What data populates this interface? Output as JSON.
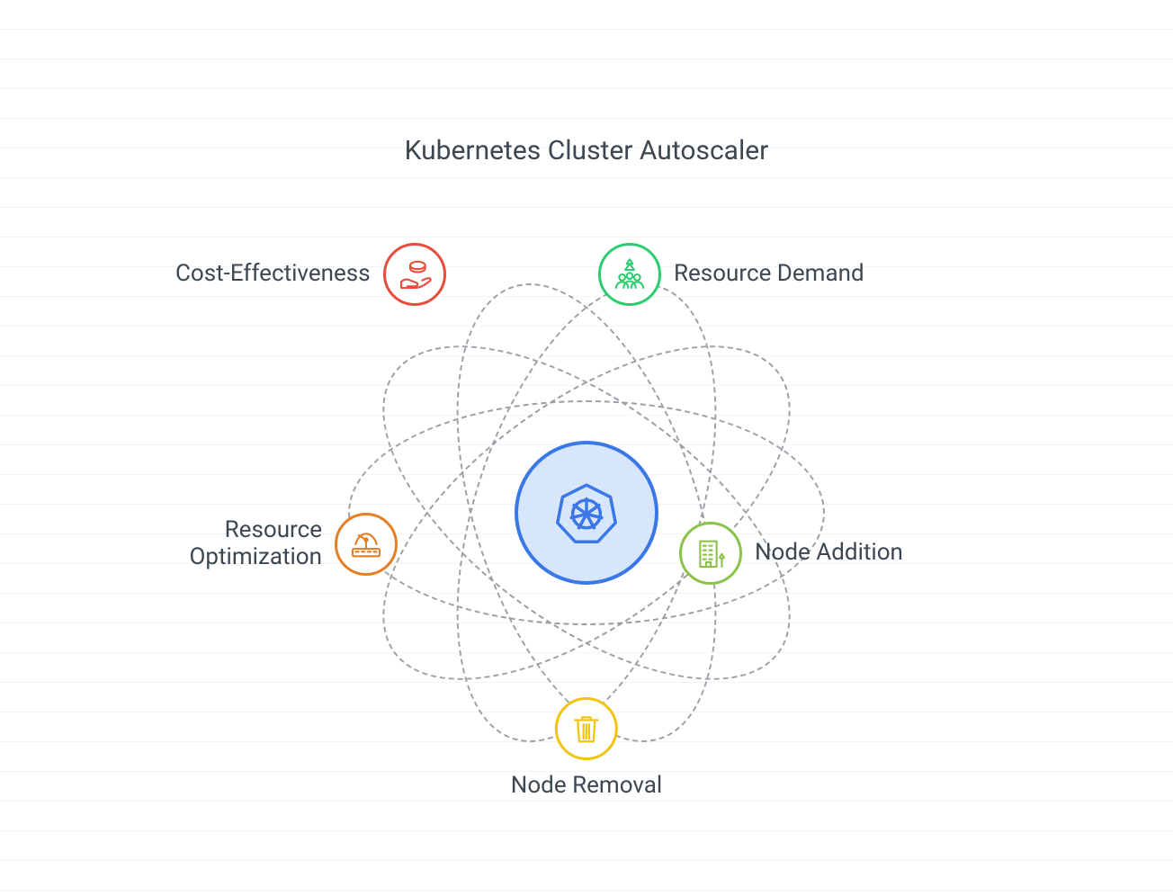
{
  "title": "Kubernetes Cluster Autoscaler",
  "center": {
    "name": "kubernetes-icon"
  },
  "nodes": [
    {
      "id": "cost",
      "label": "Cost-Effectiveness",
      "icon": "hand-money-icon",
      "color": "#e74c3c"
    },
    {
      "id": "demand",
      "label": "Resource Demand",
      "icon": "team-icon",
      "color": "#2ecc71"
    },
    {
      "id": "opt",
      "label": "Resource Optimization",
      "icon": "gauge-icon",
      "color": "#e67e22"
    },
    {
      "id": "add",
      "label": "Node Addition",
      "icon": "building-icon",
      "color": "#8bc34a"
    },
    {
      "id": "remove",
      "label": "Node Removal",
      "icon": "trash-icon",
      "color": "#f1c40f"
    }
  ]
}
